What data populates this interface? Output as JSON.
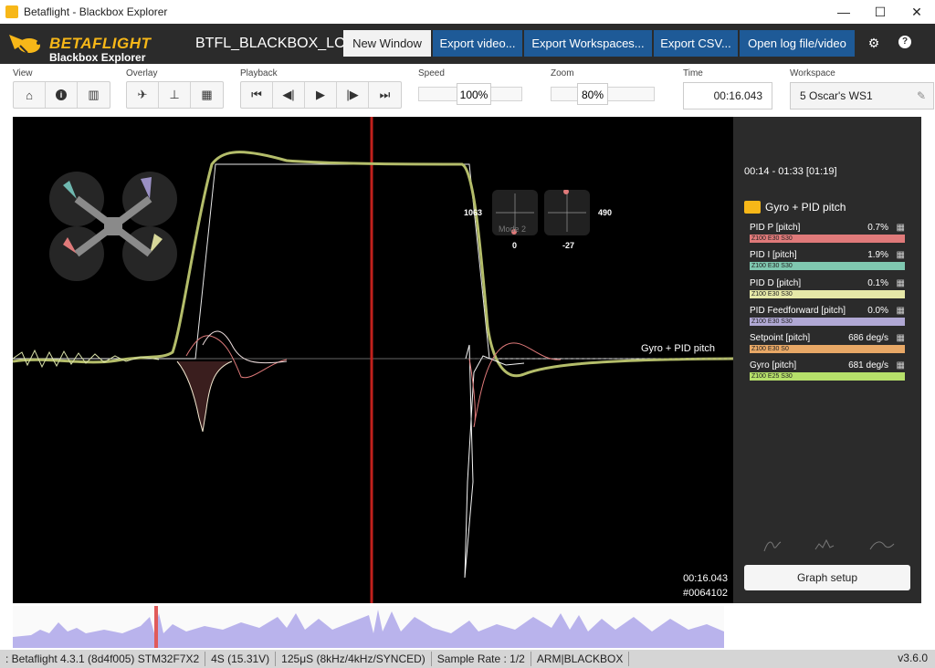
{
  "window": {
    "title": "Betaflight - Blackbox Explorer",
    "minimize": "—",
    "maximize": "☐",
    "close": "✕"
  },
  "header": {
    "logo_line1": "BETAFLIGHT",
    "logo_line2": "Blackbox Explorer",
    "log_filename": "BTFL_BLACKBOX_LOG",
    "buttons": {
      "new_window": "New Window",
      "export_video": "Export video...",
      "export_workspaces": "Export Workspaces...",
      "export_csv": "Export CSV...",
      "open_log": "Open log file/video"
    },
    "settings_icon": "gear-icon",
    "help_icon": "help-icon"
  },
  "toolbar": {
    "view_label": "View",
    "overlay_label": "Overlay",
    "playback_label": "Playback",
    "speed_label": "Speed",
    "speed_value": "100%",
    "zoom_label": "Zoom",
    "zoom_value": "80%",
    "time_label": "Time",
    "time_value": "00:16.043",
    "workspace_label": "Workspace",
    "workspace_value": "5 Oscar's WS1"
  },
  "graph": {
    "label": "Gyro + PID pitch",
    "time": "00:16.043",
    "frame": "#0064102",
    "stick_left_yaw": "1063",
    "stick_left_throttle": "0",
    "stick_right_roll": "490",
    "stick_right_pitch": "-27",
    "mode_label": "Mode 2"
  },
  "panel": {
    "time_range": "00:14 - 01:33 [01:19]",
    "group_title": "Gyro + PID pitch",
    "fields": [
      {
        "name": "PID P [pitch]",
        "value": "0.7%",
        "bar_text": "Z100 E30 S30",
        "color": "#e07a7a"
      },
      {
        "name": "PID I [pitch]",
        "value": "1.9%",
        "bar_text": "Z100 E30 S30",
        "color": "#7fc8b0"
      },
      {
        "name": "PID D [pitch]",
        "value": "0.1%",
        "bar_text": "Z100 E30 S30",
        "color": "#e6e8a8"
      },
      {
        "name": "PID Feedforward [pitch]",
        "value": "0.0%",
        "bar_text": "Z100 E30 S30",
        "color": "#b0a8d4"
      },
      {
        "name": "Setpoint [pitch]",
        "value": "686 deg/s",
        "bar_text": "Z100 E30 S0",
        "color": "#e8a866"
      },
      {
        "name": "Gyro [pitch]",
        "value": "681 deg/s",
        "bar_text": "Z100 E25 S30",
        "color": "#b6e06a"
      }
    ],
    "graph_setup": "Graph setup"
  },
  "status": {
    "firmware": ": Betaflight 4.3.1 (8d4f005) STM32F7X2",
    "battery": "4S (15.31V)",
    "loop": "125μS (8kHz/4kHz/SYNCED)",
    "sample_rate": "Sample Rate : 1/2",
    "arm": "ARM|BLACKBOX",
    "version": "v3.6.0"
  }
}
